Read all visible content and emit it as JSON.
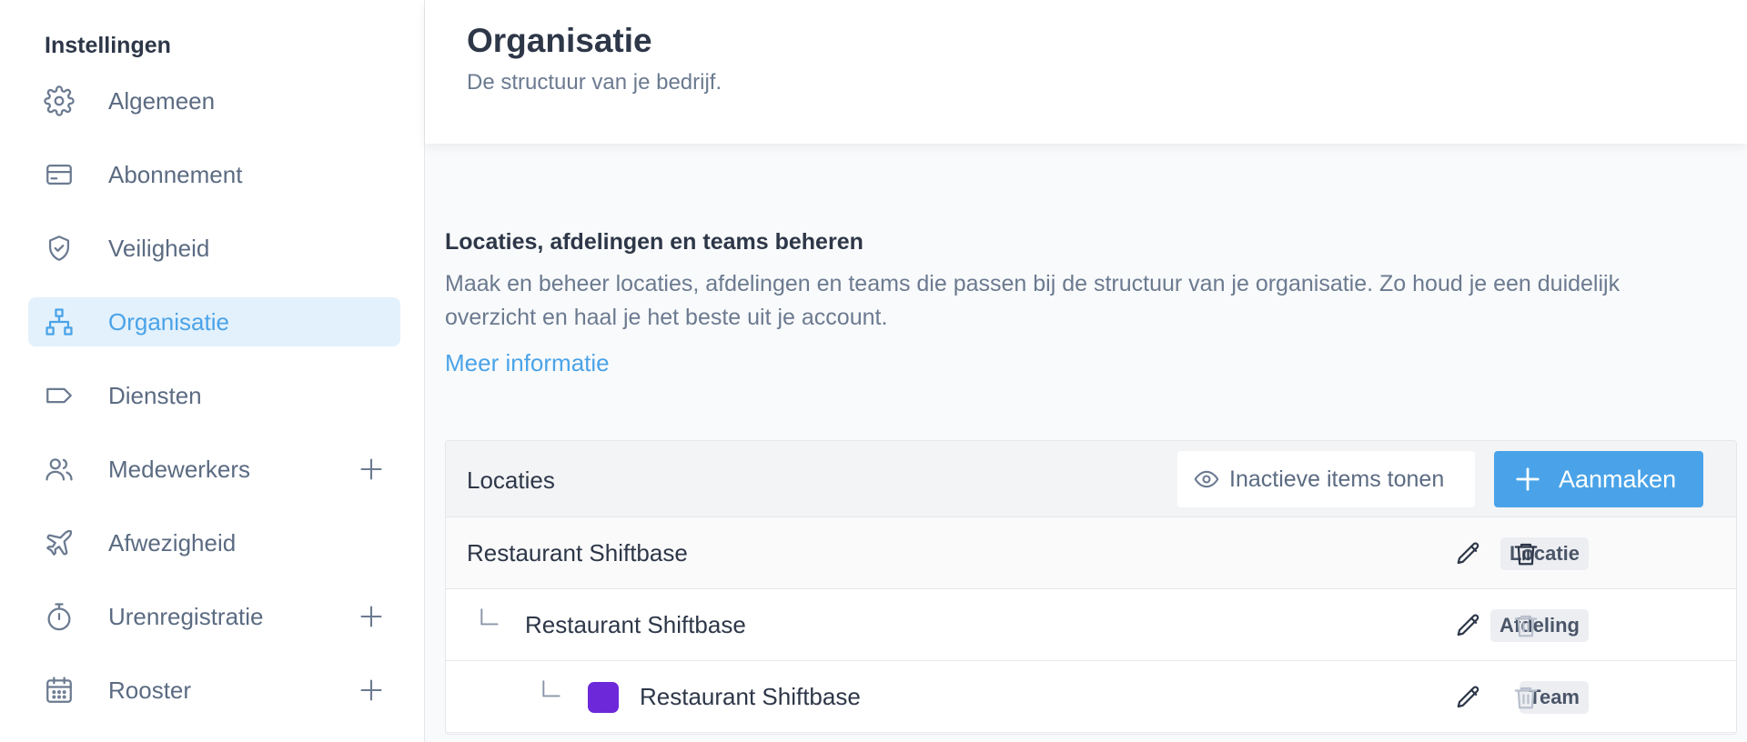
{
  "sidebar": {
    "heading": "Instellingen",
    "items": [
      {
        "label": "Algemeen",
        "icon": "gear-icon"
      },
      {
        "label": "Abonnement",
        "icon": "credit-card-icon"
      },
      {
        "label": "Veiligheid",
        "icon": "shield-check-icon"
      },
      {
        "label": "Organisatie",
        "icon": "org-chart-icon",
        "active": true
      },
      {
        "label": "Diensten",
        "icon": "tag-icon"
      },
      {
        "label": "Medewerkers",
        "icon": "users-icon",
        "has_add": true
      },
      {
        "label": "Afwezigheid",
        "icon": "plane-icon"
      },
      {
        "label": "Urenregistratie",
        "icon": "stopwatch-icon",
        "has_add": true
      },
      {
        "label": "Rooster",
        "icon": "calendar-icon",
        "has_add": true
      }
    ]
  },
  "header": {
    "title": "Organisatie",
    "subtitle": "De structuur van je bedrijf."
  },
  "section": {
    "title": "Locaties, afdelingen en teams beheren",
    "description": "Maak en beheer locaties, afdelingen en teams die passen bij de structuur van je organisatie. Zo houd je een duidelijk overzicht en haal je het beste uit je account.",
    "link": "Meer informatie"
  },
  "table": {
    "title": "Locaties",
    "show_inactive_label": "Inactieve items tonen",
    "create_label": "Aanmaken",
    "rows": [
      {
        "name": "Restaurant Shiftbase",
        "type": "Locatie",
        "level": 0,
        "delete_enabled": true
      },
      {
        "name": "Restaurant Shiftbase",
        "type": "Afdeling",
        "level": 1,
        "delete_enabled": false
      },
      {
        "name": "Restaurant Shiftbase",
        "type": "Team",
        "level": 2,
        "color": "#6d28d9",
        "delete_enabled": false
      }
    ]
  },
  "colors": {
    "accent": "#4aa3e8",
    "active_bg": "#e3f1fc",
    "team_color": "#6d28d9"
  }
}
